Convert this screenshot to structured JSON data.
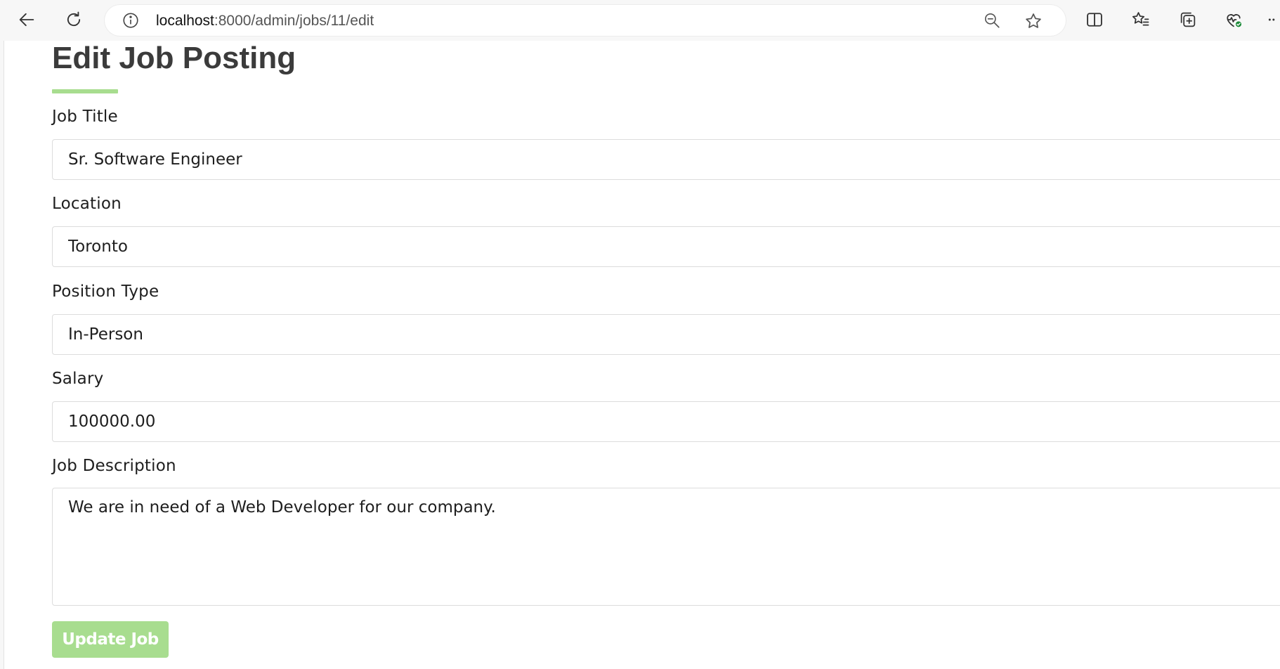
{
  "browser": {
    "url_host": "localhost",
    "url_path": ":8000/admin/jobs/11/edit",
    "icons": [
      "back-icon",
      "refresh-icon",
      "info-icon",
      "zoom-out-icon",
      "favorite-star-icon",
      "split-screen-icon",
      "favorites-list-icon",
      "collections-icon",
      "browser-health-icon",
      "more-icon"
    ]
  },
  "form": {
    "title": "Edit Job Posting",
    "accent_color": "#a8dd8f",
    "job_title": {
      "label": "Job Title",
      "value": "Sr. Software Engineer"
    },
    "location": {
      "label": "Location",
      "value": "Toronto"
    },
    "position_type": {
      "label": "Position Type",
      "value": "In-Person"
    },
    "salary": {
      "label": "Salary",
      "value": "100000.00"
    },
    "description": {
      "label": "Job Description",
      "value": "We are in need of a Web Developer for our company."
    },
    "submit_label": "Update Job"
  }
}
